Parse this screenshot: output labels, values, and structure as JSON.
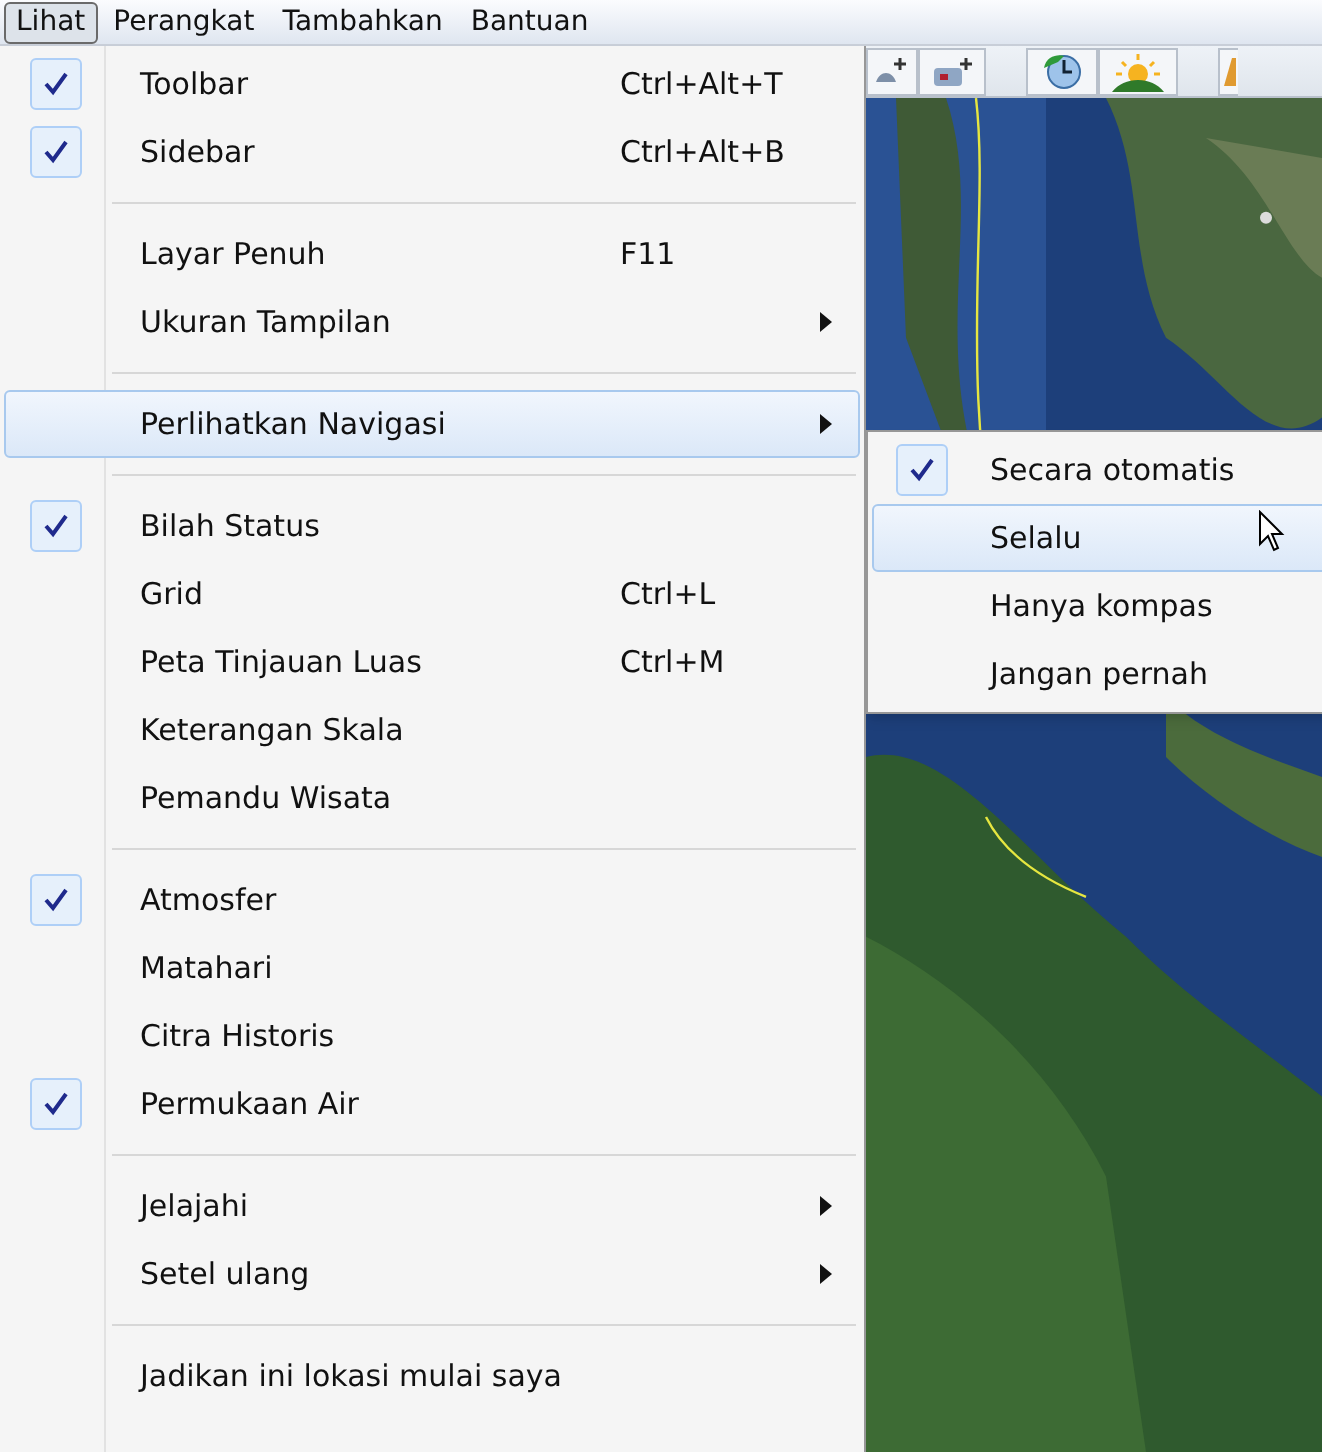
{
  "menu_bar": [
    {
      "label": "Lihat",
      "selected": true
    },
    {
      "label": "Perangkat",
      "selected": false
    },
    {
      "label": "Tambahkan",
      "selected": false
    },
    {
      "label": "Bantuan",
      "selected": false
    }
  ],
  "menu": {
    "items": [
      {
        "kind": "item",
        "label": "Toolbar",
        "shortcut": "Ctrl+Alt+T",
        "checked": true,
        "submenu": false,
        "selected": false
      },
      {
        "kind": "item",
        "label": "Sidebar",
        "shortcut": "Ctrl+Alt+B",
        "checked": true,
        "submenu": false,
        "selected": false
      },
      {
        "kind": "separator"
      },
      {
        "kind": "item",
        "label": "Layar Penuh",
        "shortcut": "F11",
        "checked": false,
        "submenu": false,
        "selected": false
      },
      {
        "kind": "item",
        "label": "Ukuran Tampilan",
        "checked": false,
        "submenu": true,
        "selected": false
      },
      {
        "kind": "separator"
      },
      {
        "kind": "item",
        "label": "Perlihatkan Navigasi",
        "checked": false,
        "submenu": true,
        "selected": true
      },
      {
        "kind": "separator"
      },
      {
        "kind": "item",
        "label": "Bilah Status",
        "checked": true,
        "submenu": false,
        "selected": false
      },
      {
        "kind": "item",
        "label": "Grid",
        "shortcut": "Ctrl+L",
        "checked": false,
        "submenu": false,
        "selected": false
      },
      {
        "kind": "item",
        "label": "Peta Tinjauan Luas",
        "shortcut": "Ctrl+M",
        "checked": false,
        "submenu": false,
        "selected": false
      },
      {
        "kind": "item",
        "label": "Keterangan Skala",
        "checked": false,
        "submenu": false,
        "selected": false
      },
      {
        "kind": "item",
        "label": "Pemandu Wisata",
        "checked": false,
        "submenu": false,
        "selected": false
      },
      {
        "kind": "separator"
      },
      {
        "kind": "item",
        "label": "Atmosfer",
        "checked": true,
        "submenu": false,
        "selected": false
      },
      {
        "kind": "item",
        "label": "Matahari",
        "checked": false,
        "submenu": false,
        "selected": false
      },
      {
        "kind": "item",
        "label": "Citra Historis",
        "checked": false,
        "submenu": false,
        "selected": false
      },
      {
        "kind": "item",
        "label": "Permukaan Air",
        "checked": true,
        "submenu": false,
        "selected": false
      },
      {
        "kind": "separator"
      },
      {
        "kind": "item",
        "label": "Jelajahi",
        "checked": false,
        "submenu": true,
        "selected": false
      },
      {
        "kind": "item",
        "label": "Setel ulang",
        "checked": false,
        "submenu": true,
        "selected": false
      },
      {
        "kind": "separator"
      },
      {
        "kind": "item",
        "label": "Jadikan ini lokasi mulai saya",
        "checked": false,
        "submenu": false,
        "selected": false
      }
    ]
  },
  "submenu": {
    "items": [
      {
        "label": "Secara otomatis",
        "checked": true,
        "selected": false
      },
      {
        "label": "Selalu",
        "checked": false,
        "selected": true
      },
      {
        "label": "Hanya kompas",
        "checked": false,
        "selected": false
      },
      {
        "label": "Jangan pernah",
        "checked": false,
        "selected": false
      }
    ]
  }
}
